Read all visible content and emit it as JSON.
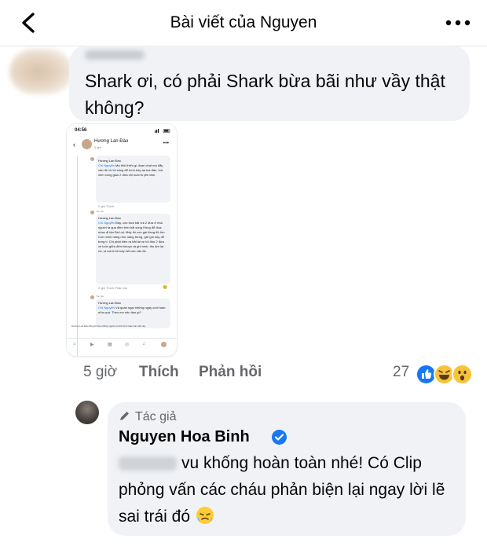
{
  "header": {
    "title": "Bài viết của Nguyen"
  },
  "comment1": {
    "text": "Shark ơi, có phải Shark bừa bãi như vầy thật không?",
    "time": "5 giờ",
    "like_label": "Thích",
    "reply_label": "Phản hồi",
    "reaction_count": "27",
    "reactions": [
      "like",
      "laugh",
      "wow"
    ]
  },
  "screenshot": {
    "time": "04:56",
    "title": "Hương Lan Đào",
    "subtitle": "4 giờ",
    "replies": [
      {
        "author": "Hương Lan Đào",
        "mention": "Chi Nguyễn",
        "text": "Mà thôi thiếu gì đoạn chat mà đẩy vấn đề về lối sống để trình bày tại toà đâu, toà xem xong giao 2 đứa chị nuôi là yên tâm.",
        "meta": "2 giờ    Thích"
      },
      {
        "tag": "Tác giả",
        "author": "Hương Lan Đào",
        "mention": "Chi Nguyễn",
        "text": "Đây, còn bừa bãi vút 2 đứa ở nhà người ta qua đêm trên bãi sông Hồng để đưa nhau đi tận Đà Lạt, Mấy thì con gái đang độ lớn. Con mình nâng như nâng trứng, giữ gìn dạy dỗ từng tí. Chị phát hiện ra bắt lái xe tối đón 2 đứa về luôn giữa đêm khuya và ghi hình, thu âm lại rồi, ra toà trình bày hết các vấn đề.",
        "meta": "2 giờ    Thích    Phản hồi"
      },
      {
        "tag": "Tác giả",
        "author": "Hương Lan Đào",
        "mention": "Chi Nguyễn",
        "text": "Và quan ngại những ngày cuối tuần nữa quá. Theo em nên làm gì?",
        "meta": ""
      }
    ],
    "footer": "Hương Lan Đào đã giới hạn những người có thể bình luận bài viết này."
  },
  "comment2": {
    "badge": "Tác giả",
    "author": "Nguyen Hoa Binh",
    "text": "vu khống hoàn toàn nhé! Có Clip phỏng vấn các cháu phản biện lại ngay lời lẽ sai trái đó"
  },
  "colors": {
    "bubble": "#f0f2f5",
    "meta": "#65676b",
    "accent": "#1877f2"
  }
}
